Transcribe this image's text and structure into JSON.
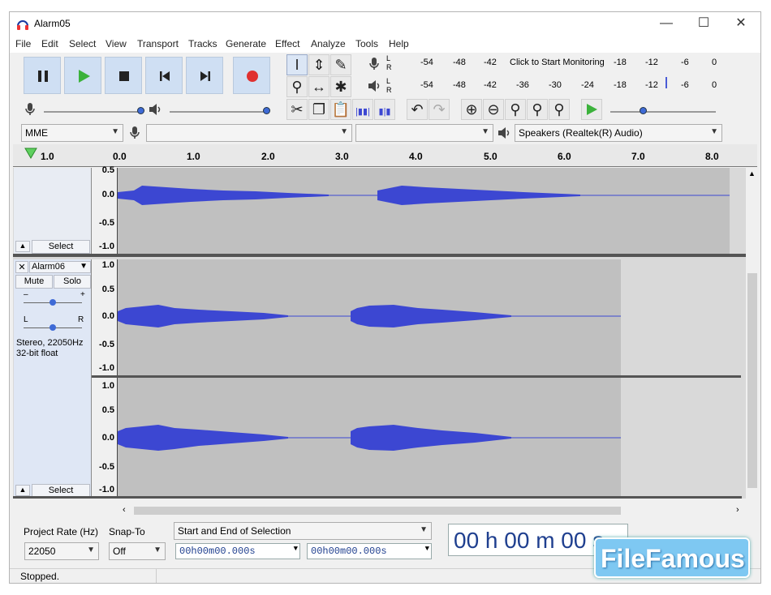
{
  "window": {
    "title": "Alarm05",
    "min": "—",
    "max": "☐",
    "close": "✕"
  },
  "menu": [
    "File",
    "Edit",
    "Select",
    "View",
    "Transport",
    "Tracks",
    "Generate",
    "Effect",
    "Analyze",
    "Tools",
    "Help"
  ],
  "meters": {
    "record_ticks": [
      "-54",
      "-48",
      "-42",
      "Click to Start Monitoring",
      "-18",
      "-12",
      "-6",
      "0"
    ],
    "play_ticks": [
      "-54",
      "-48",
      "-42",
      "-36",
      "-30",
      "-24",
      "-18",
      "-12",
      "-6",
      "0"
    ],
    "lr": [
      "L",
      "R"
    ]
  },
  "device": {
    "host": "MME",
    "output": "Speakers (Realtek(R) Audio)",
    "input": "",
    "channels": ""
  },
  "ruler": {
    "ticks": [
      "1.0",
      "0.0",
      "1.0",
      "2.0",
      "3.0",
      "4.0",
      "5.0",
      "6.0",
      "7.0",
      "8.0"
    ]
  },
  "track1": {
    "scale": [
      "0.5",
      "0.0",
      "-0.5",
      "-1.0"
    ],
    "select_label": "Select"
  },
  "track2": {
    "name": "Alarm06",
    "mute": "Mute",
    "solo": "Solo",
    "gain_minus": "–",
    "gain_plus": "+",
    "pan_l": "L",
    "pan_r": "R",
    "info_line1": "Stereo, 22050Hz",
    "info_line2": "32-bit float",
    "scale_top": [
      "1.0",
      "0.5",
      "0.0",
      "-0.5",
      "-1.0"
    ],
    "scale_bottom": [
      "1.0",
      "0.5",
      "0.0",
      "-0.5",
      "-1.0"
    ],
    "select_label": "Select"
  },
  "bottom": {
    "project_rate_label": "Project Rate (Hz)",
    "project_rate": "22050",
    "snap_label": "Snap-To",
    "snap_value": "Off",
    "selection_mode": "Start and End of Selection",
    "time_start": "00h00m00.000s",
    "time_end": "00h00m00.000s",
    "big_time": "00 h 00 m 00 s"
  },
  "status": "Stopped.",
  "watermark": "FileFamous",
  "colors": {
    "wave": "#3c47d2",
    "track_selected_bg": "#dfe7f5",
    "play_green": "#3bb23b",
    "record_red": "#e03030"
  }
}
